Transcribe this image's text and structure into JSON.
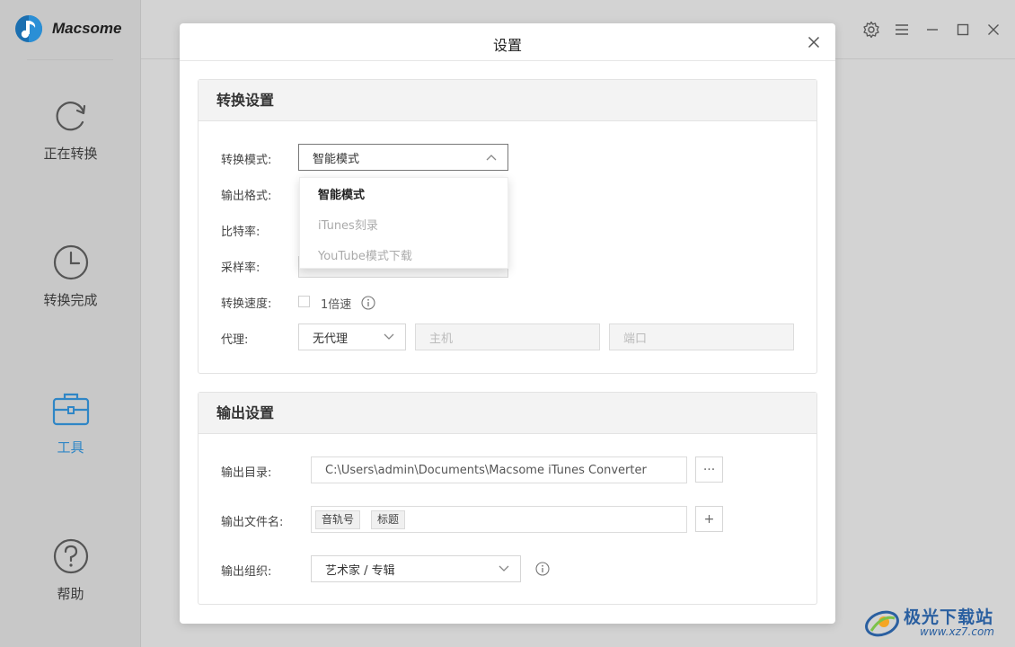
{
  "app": {
    "name": "Macsome"
  },
  "sidebar": {
    "items": [
      {
        "label": "正在转换",
        "icon": "refresh-icon",
        "active": false
      },
      {
        "label": "转换完成",
        "icon": "clock-icon",
        "active": false
      },
      {
        "label": "工具",
        "icon": "toolbox-icon",
        "active": true
      },
      {
        "label": "帮助",
        "icon": "help-icon",
        "active": false
      }
    ]
  },
  "window_controls": [
    "gear-icon",
    "menu-icon",
    "minimize-icon",
    "maximize-icon",
    "close-icon"
  ],
  "dialog": {
    "title": "设置",
    "convert_section": {
      "title": "转换设置",
      "mode_label": "转换模式:",
      "mode_value": "智能模式",
      "format_label": "输出格式:",
      "bitrate_label": "比特率:",
      "samplerate_label": "采样率:",
      "speed_label": "转换速度:",
      "speed_checkbox_label": "1倍速",
      "proxy_label": "代理:",
      "proxy_value": "无代理",
      "host_placeholder": "主机",
      "port_placeholder": "端口"
    },
    "mode_dropdown": {
      "options": [
        {
          "label": "智能模式",
          "selected": true
        },
        {
          "label": "iTunes刻录",
          "selected": false
        },
        {
          "label": "YouTube模式下载",
          "selected": false
        }
      ]
    },
    "output_section": {
      "title": "输出设置",
      "dir_label": "输出目录:",
      "dir_value": "C:\\Users\\admin\\Documents\\Macsome iTunes Converter",
      "browse_label": "···",
      "filename_label": "输出文件名:",
      "filename_tags": [
        "音轨号",
        "标题"
      ],
      "add_label": "+",
      "organize_label": "输出组织:",
      "organize_value": "艺术家 / 专辑"
    }
  },
  "watermark": {
    "text": "极光下载站",
    "url": "www.xz7.com"
  },
  "colors": {
    "accent": "#2f86c6",
    "sidebar_bg": "#c8c8c8",
    "overlay": "#d3d3d3"
  }
}
